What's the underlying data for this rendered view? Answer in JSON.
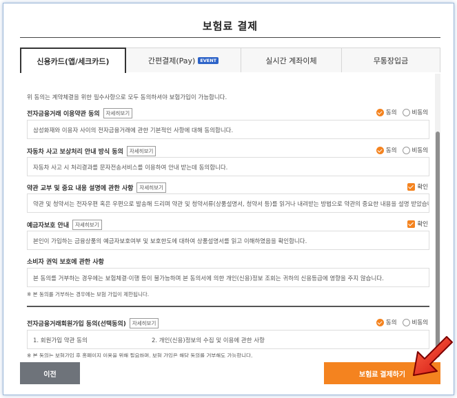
{
  "page_title": "보험료 결제",
  "tabs": [
    {
      "label": "신용카드(앱/세크카드)"
    },
    {
      "label": "간편결제(Pay)",
      "badge": "EVENT"
    },
    {
      "label": "실시간 계좌이체"
    },
    {
      "label": "무통장입금"
    }
  ],
  "notice": "위 동의는 계약체결을 위한 필수사항으로 모두 동의하셔야 보험가입이 가능합니다.",
  "detail_label": "자세히보기",
  "agree_label": "동의",
  "disagree_label": "비동의",
  "confirm_label": "확인",
  "sections": [
    {
      "title": "전자금융거래 이용약관 동의",
      "body": "삼성화재와 이용자 사이의 전자금융거래에 관한 기본적인 사항에 대해 동의합니다."
    },
    {
      "title": "자동차 사고 보상처리 안내 방식 동의",
      "body": "자동차 사고 시 처리결과를 문자전송서비스를 이용하여 안내 받는데 동의합니다."
    },
    {
      "title": "약관 교부 및 중요 내용 설명에 관한 사항",
      "body": "약관 및 청약서는 전자우편 혹은 우편으로 발송해 드리며 약관 및 청약서류(상품설명서, 청약서 등)를 읽거나 내려받는 방법으로 약관의 중요한 내용을 설명 받았습니다."
    },
    {
      "title": "예금자보호 안내",
      "body": "본인이 가입하는 금융상품의 예금자보호여부 및 보호한도에 대하여 상품설명서를 읽고 이해하였음을 확인합니다."
    },
    {
      "title": "소비자 권익 보호에 관한 사항",
      "body": "본 동의를 거부하는 경우에는 보험체결·이행 등이 불가능하며 본 동의서에 의한 개인(신용)정보 조회는 귀하의 신용등급에 영향을 주지 않습니다."
    },
    {
      "title": "전자금융거래회원가입 동의(선택동의)"
    }
  ],
  "consumer_note": "※ 본 동의를 거부하는 경우에는 보험 가입이 제한됩니다.",
  "membership_items": [
    "1. 회원가입 약관 동의",
    "2. 개인(신용)정보의 수집 및 이용에 관한 사항"
  ],
  "membership_note": "※ 본 동의는 보험가입 후 홈페이지 이용을 위해 필요하며, 보험 가입은 해당 동의를 거부해도 가능합니다.",
  "buttons": {
    "prev": "이전",
    "pay": "보험료 결제하기"
  },
  "colors": {
    "accent": "#f4831f",
    "prev_button": "#6e737a",
    "event_badge": "#2d63c8",
    "arrow": "#e0201c"
  }
}
